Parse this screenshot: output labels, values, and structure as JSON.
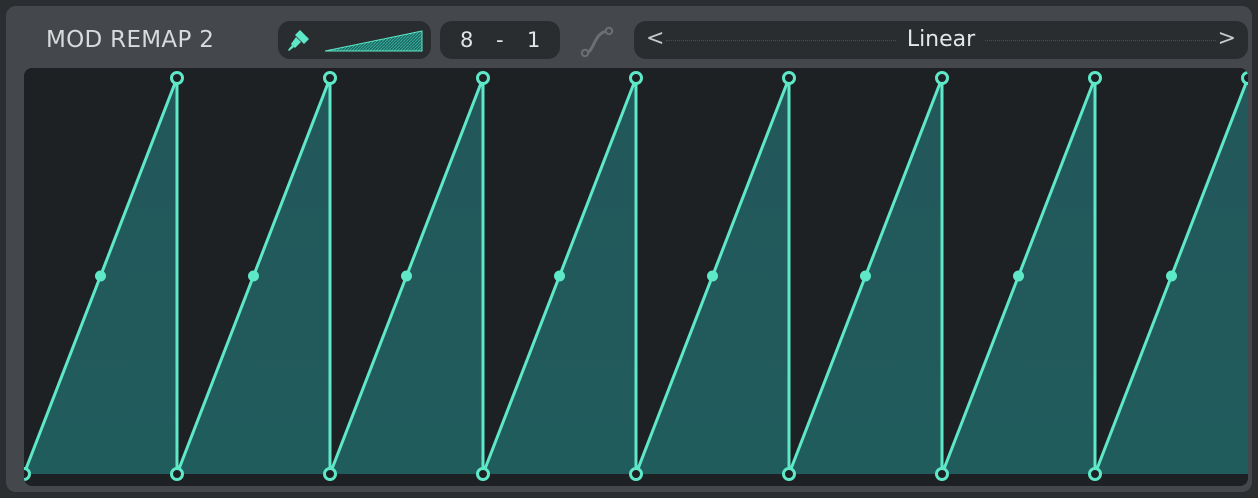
{
  "header": {
    "title": "MOD REMAP 2",
    "step_left": "8",
    "step_sep": "-",
    "step_right": "1",
    "preset_prev": "<",
    "preset_name": "Linear",
    "preset_next": ">"
  },
  "icons": {
    "paint": "paint-brush-icon",
    "ramp": "ramp-shape-icon",
    "curve": "curve-smooth-icon"
  },
  "colors": {
    "accent": "#5ee8c8",
    "fill": "#22575a",
    "panel": "#44484c",
    "background": "#1e2124"
  },
  "chart_data": {
    "type": "area",
    "x": [
      0,
      0.125,
      0.125,
      0.25,
      0.25,
      0.375,
      0.375,
      0.5,
      0.5,
      0.625,
      0.625,
      0.75,
      0.75,
      0.875,
      0.875,
      1.0
    ],
    "values": [
      0,
      1,
      0,
      1,
      0,
      1,
      0,
      1,
      0,
      1,
      0,
      1,
      0,
      1,
      0,
      1
    ],
    "midpoints": [
      {
        "x": 0.0625,
        "y": 0.5
      },
      {
        "x": 0.1875,
        "y": 0.5
      },
      {
        "x": 0.3125,
        "y": 0.5
      },
      {
        "x": 0.4375,
        "y": 0.5
      },
      {
        "x": 0.5625,
        "y": 0.5
      },
      {
        "x": 0.6875,
        "y": 0.5
      },
      {
        "x": 0.8125,
        "y": 0.5
      },
      {
        "x": 0.9375,
        "y": 0.5
      }
    ],
    "xlim": [
      0,
      1
    ],
    "ylim": [
      0,
      1
    ],
    "grid": false
  }
}
